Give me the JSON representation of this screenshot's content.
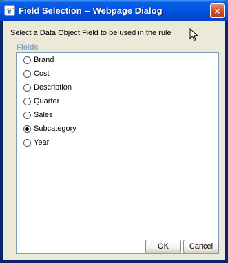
{
  "window": {
    "title": "Field Selection -- Webpage Dialog",
    "close_glyph": "×",
    "app_icon": "ie-icon"
  },
  "dialog": {
    "instruction": "Select a Data Object Field to be used in the rule",
    "fields_label": "Fields",
    "options": [
      {
        "label": "Brand",
        "checked": false
      },
      {
        "label": "Cost",
        "checked": false
      },
      {
        "label": "Description",
        "checked": false
      },
      {
        "label": "Quarter",
        "checked": false
      },
      {
        "label": "Sales",
        "checked": false
      },
      {
        "label": "Subcategory",
        "checked": true
      },
      {
        "label": "Year",
        "checked": false
      }
    ],
    "selected": "Subcategory"
  },
  "buttons": {
    "ok": "OK",
    "cancel": "Cancel"
  },
  "colors": {
    "titlebar": "#0054e3",
    "client_bg": "#ece9d8",
    "fields_label": "#8aa6c8",
    "close_button": "#d2512c"
  }
}
